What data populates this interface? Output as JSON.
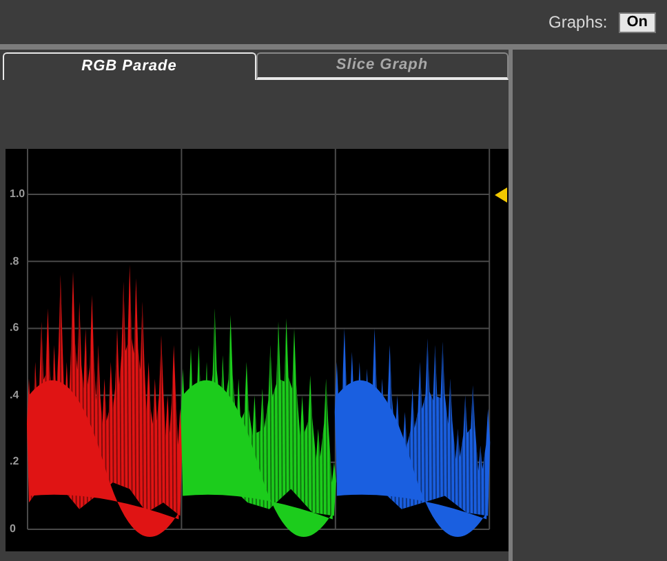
{
  "header": {
    "label": "Graphs:",
    "toggle": {
      "text": "On",
      "on": true
    }
  },
  "tabs": [
    {
      "label": "RGB Parade",
      "selected": true
    },
    {
      "label": "Slice Graph",
      "selected": false
    }
  ],
  "scope": {
    "y_ticks": [
      "1.0",
      ".8",
      ".6",
      ".4",
      ".2",
      "0"
    ]
  },
  "channels": [
    {
      "color": "#e01414"
    },
    {
      "color": "#1ccc1c"
    },
    {
      "color": "#1a5fe0"
    }
  ]
}
